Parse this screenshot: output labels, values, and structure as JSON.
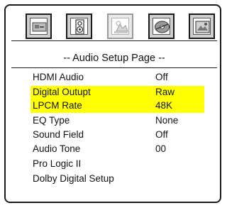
{
  "tabs": [
    {
      "icon": "general-setup-icon",
      "active": false
    },
    {
      "icon": "audio-speaker-icon",
      "active": false
    },
    {
      "icon": "video-setup-icon",
      "active": true
    },
    {
      "icon": "disc-preference-icon",
      "active": false
    },
    {
      "icon": "picture-settings-icon",
      "active": false
    }
  ],
  "page_title": "-- Audio Setup Page --",
  "highlight_color": "#ffff00",
  "rows": [
    {
      "label": "HDMI Audio",
      "value": "Off",
      "highlighted": false
    },
    {
      "label": "Digital Outupt",
      "value": "Raw",
      "highlighted": true
    },
    {
      "label": "LPCM Rate",
      "value": "48K",
      "highlighted": true
    },
    {
      "label": "EQ Type",
      "value": "None",
      "highlighted": false
    },
    {
      "label": "Sound Field",
      "value": "Off",
      "highlighted": false
    },
    {
      "label": "Audio Tone",
      "value": "00",
      "highlighted": false
    },
    {
      "label": "Pro Logic II",
      "value": "",
      "highlighted": false
    },
    {
      "label": "Dolby Digital Setup",
      "value": "",
      "highlighted": false
    }
  ]
}
